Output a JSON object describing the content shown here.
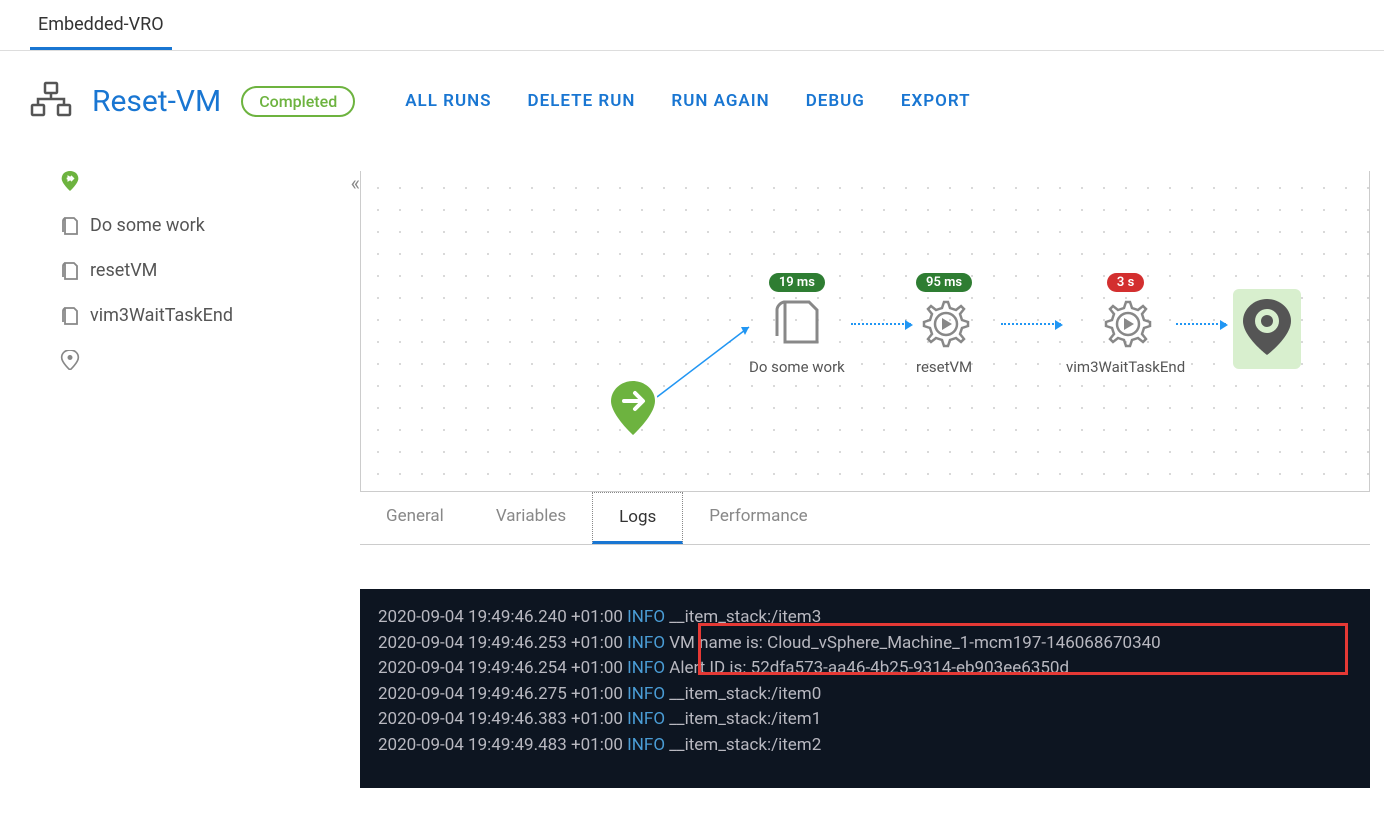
{
  "topTab": "Embedded-VRO",
  "workflow": {
    "title": "Reset-VM",
    "status": "Completed"
  },
  "actions": {
    "allRuns": "ALL RUNS",
    "deleteRun": "DELETE RUN",
    "runAgain": "RUN AGAIN",
    "debug": "DEBUG",
    "export": "EXPORT"
  },
  "steps": [
    "Do some work",
    "resetVM",
    "vim3WaitTaskEnd"
  ],
  "canvas": {
    "nodes": [
      {
        "label": "Do some work",
        "badge": "19 ms",
        "badgeColor": "green"
      },
      {
        "label": "resetVM",
        "badge": "95 ms",
        "badgeColor": "green"
      },
      {
        "label": "vim3WaitTaskEnd",
        "badge": "3 s",
        "badgeColor": "red"
      }
    ]
  },
  "detailTabs": {
    "general": "General",
    "variables": "Variables",
    "logs": "Logs",
    "performance": "Performance"
  },
  "logs": [
    {
      "ts": "2020-09-04 19:49:46.240 +01:00",
      "level": "INFO",
      "msg": "__item_stack:/item3"
    },
    {
      "ts": "2020-09-04 19:49:46.253 +01:00",
      "level": "INFO",
      "msg": "VM name is: Cloud_vSphere_Machine_1-mcm197-146068670340"
    },
    {
      "ts": "2020-09-04 19:49:46.254 +01:00",
      "level": "INFO",
      "msg": "Alert ID is: 52dfa573-aa46-4b25-9314-eb903ee6350d"
    },
    {
      "ts": "2020-09-04 19:49:46.275 +01:00",
      "level": "INFO",
      "msg": "__item_stack:/item0"
    },
    {
      "ts": "2020-09-04 19:49:46.383 +01:00",
      "level": "INFO",
      "msg": "__item_stack:/item1"
    },
    {
      "ts": "2020-09-04 19:49:49.483 +01:00",
      "level": "INFO",
      "msg": "__item_stack:/item2"
    }
  ]
}
